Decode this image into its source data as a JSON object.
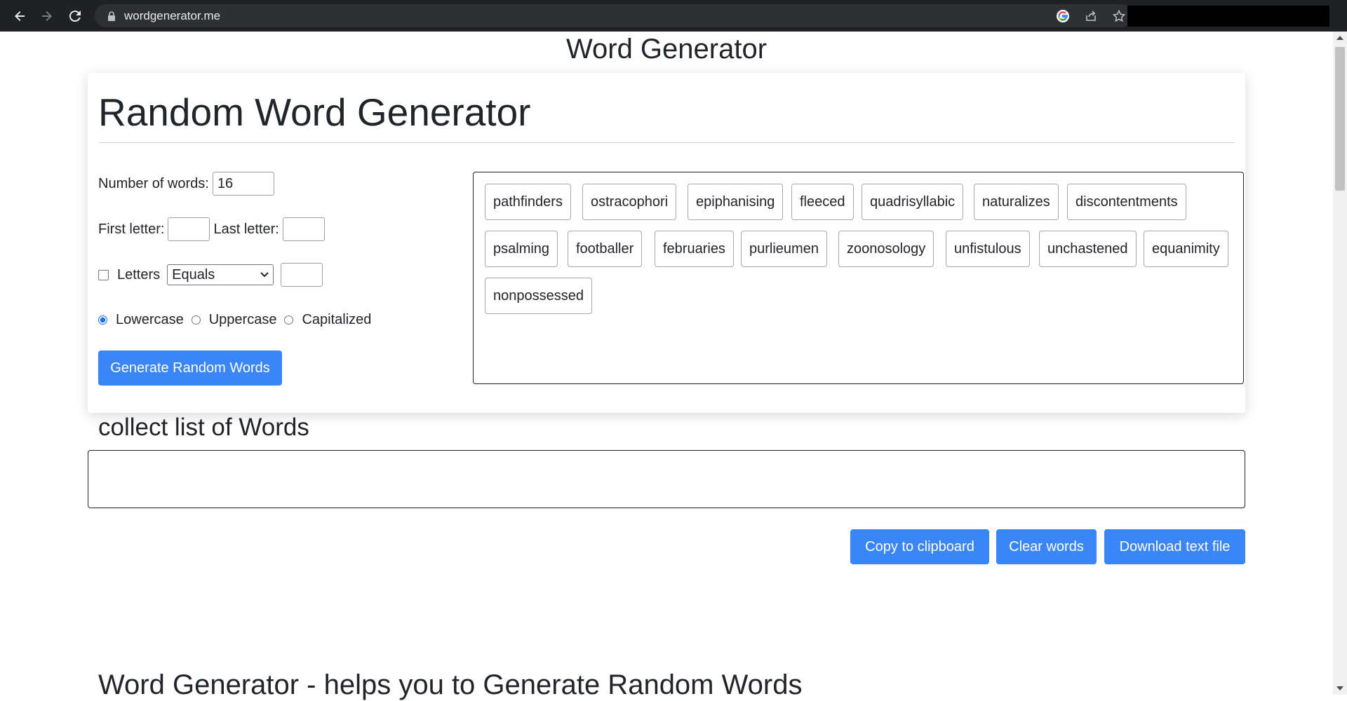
{
  "browser": {
    "url": "wordgenerator.me"
  },
  "page": {
    "site_title": "Word Generator",
    "card_title": "Random Word Generator",
    "form": {
      "num_words_label": "Number of words:",
      "num_words_value": "16",
      "first_letter_label": "First letter:",
      "last_letter_label": "Last letter:",
      "letters_label": "Letters",
      "letters_compare_selected": "Equals",
      "case_options": [
        "Lowercase",
        "Uppercase",
        "Capitalized"
      ],
      "case_selected": "Lowercase",
      "generate_button": "Generate Random Words"
    },
    "words": [
      "pathfinders",
      "ostracophori",
      "epiphanising",
      "fleeced",
      "quadrisyllabic",
      "naturalizes",
      "discontentments",
      "psalming",
      "footballer",
      "februaries",
      "purlieumen",
      "zoonosology",
      "unfistulous",
      "unchastened",
      "equanimity",
      "nonpossessed"
    ],
    "collect_title": "collect list of Words",
    "actions": {
      "copy": "Copy to clipboard",
      "clear": "Clear words",
      "download": "Download text file"
    },
    "bottom_heading": "Word Generator - helps you to Generate Random Words"
  }
}
